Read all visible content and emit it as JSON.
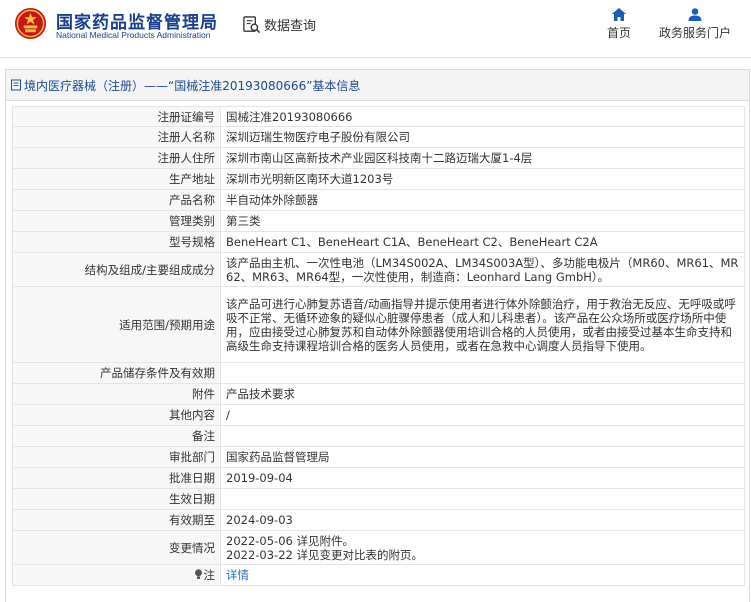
{
  "header": {
    "logo_cn": "国家药品监督管理局",
    "logo_en": "National Medical Products Administration",
    "query_label": "数据查询",
    "nav": [
      {
        "label": "首页",
        "icon": "home-icon"
      },
      {
        "label": "政务服务门户",
        "icon": "user-icon"
      }
    ]
  },
  "title_bar": {
    "text": "境内医疗器械（注册）——“国械注准20193080666”基本信息"
  },
  "rows": {
    "reg_no": {
      "label": "注册证编号",
      "value": "国械注准20193080666"
    },
    "registrant": {
      "label": "注册人名称",
      "value": "深圳迈瑞生物医疗电子股份有限公司"
    },
    "registrant_addr": {
      "label": "注册人住所",
      "value": "深圳市南山区高新技术产业园区科技南十二路迈瑞大厦1-4层"
    },
    "mfg_addr": {
      "label": "生产地址",
      "value": "深圳市光明新区南环大道1203号"
    },
    "product_name": {
      "label": "产品名称",
      "value": "半自动体外除颤器"
    },
    "mgmt_class": {
      "label": "管理类别",
      "value": "第三类"
    },
    "models": {
      "label": "型号规格",
      "value": "BeneHeart C1、BeneHeart C1A、BeneHeart C2、BeneHeart C2A"
    },
    "composition": {
      "label": "结构及组成/主要组成成分",
      "value": "该产品由主机、一次性电池（LM34S002A、LM34S003A型）、多功能电极片（MR60、MR61、MR62、MR63、MR64型，一次性使用，制造商：Leonhard Lang GmbH）。"
    },
    "scope": {
      "label": "适用范围/预期用途",
      "value": "该产品可进行心肺复苏语音/动画指导并提示使用者进行体外除颤治疗，用于救治无反应、无呼吸或呼吸不正常、无循环迹象的疑似心脏骤停患者（成人和儿科患者）。该产品在公众场所或医疗场所中使用，应由接受过心肺复苏和自动体外除颤器使用培训合格的人员使用，或者由接受过基本生命支持和高级生命支持课程培训合格的医务人员使用，或者在急救中心调度人员指导下使用。"
    },
    "storage": {
      "label": "产品储存条件及有效期",
      "value": ""
    },
    "attachment": {
      "label": "附件",
      "value": "产品技术要求"
    },
    "other": {
      "label": "其他内容",
      "value": "/"
    },
    "remark": {
      "label": "备注",
      "value": ""
    },
    "approval_dept": {
      "label": "审批部门",
      "value": "国家药品监督管理局"
    },
    "approval_date": {
      "label": "批准日期",
      "value": "2019-09-04"
    },
    "effective_date": {
      "label": "生效日期",
      "value": ""
    },
    "expiry": {
      "label": "有效期至",
      "value": "2024-09-03"
    },
    "changes": {
      "label": "变更情况",
      "lines": [
        "2022-05-06 详见附件。",
        "2022-03-22 详见变更对比表的附页。"
      ]
    },
    "note": {
      "label": "注",
      "value": "详情"
    }
  },
  "colors": {
    "brand_blue": "#1a3f8e",
    "link_blue": "#1f6fc6",
    "label_bg": "#f7f7f7"
  }
}
